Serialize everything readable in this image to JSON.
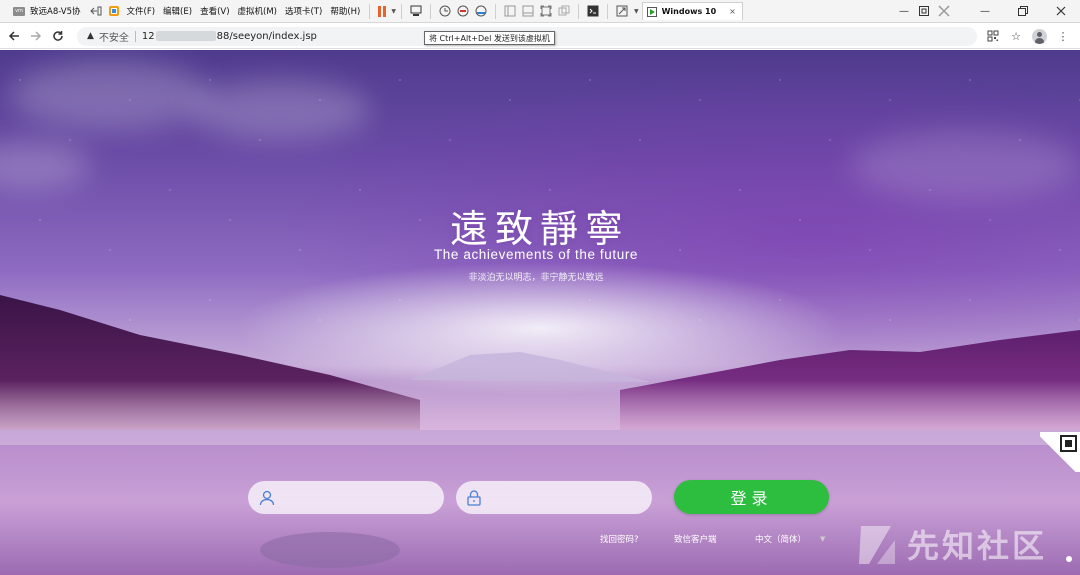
{
  "vmware": {
    "window_title": "致远A8-V5协",
    "menu": [
      "文件(F)",
      "编辑(E)",
      "查看(V)",
      "虚拟机(M)",
      "选项卡(T)",
      "帮助(H)"
    ],
    "tab_label": "Windows 10",
    "tab_close": "×",
    "tooltip": "将 Ctrl+Alt+Del 发送到该虚拟机"
  },
  "browser": {
    "security_label": "不安全",
    "url_prefix": "12",
    "url_suffix": "88/seeyon/index.jsp"
  },
  "hero": {
    "title": "遠致靜寧",
    "subtitle": "The achievements of the future",
    "slogan": "非淡泊无以明志，非宁静无以致远"
  },
  "login": {
    "username_placeholder": "",
    "password_placeholder": "",
    "button_label": "登录",
    "forgot_password": "找回密码?",
    "wechat_client": "致信客户端",
    "language": "中文（简体）"
  },
  "watermark": {
    "text": "先知社区"
  },
  "colors": {
    "login_button": "#2dbd3f",
    "pause_icon": "#e8632a"
  }
}
